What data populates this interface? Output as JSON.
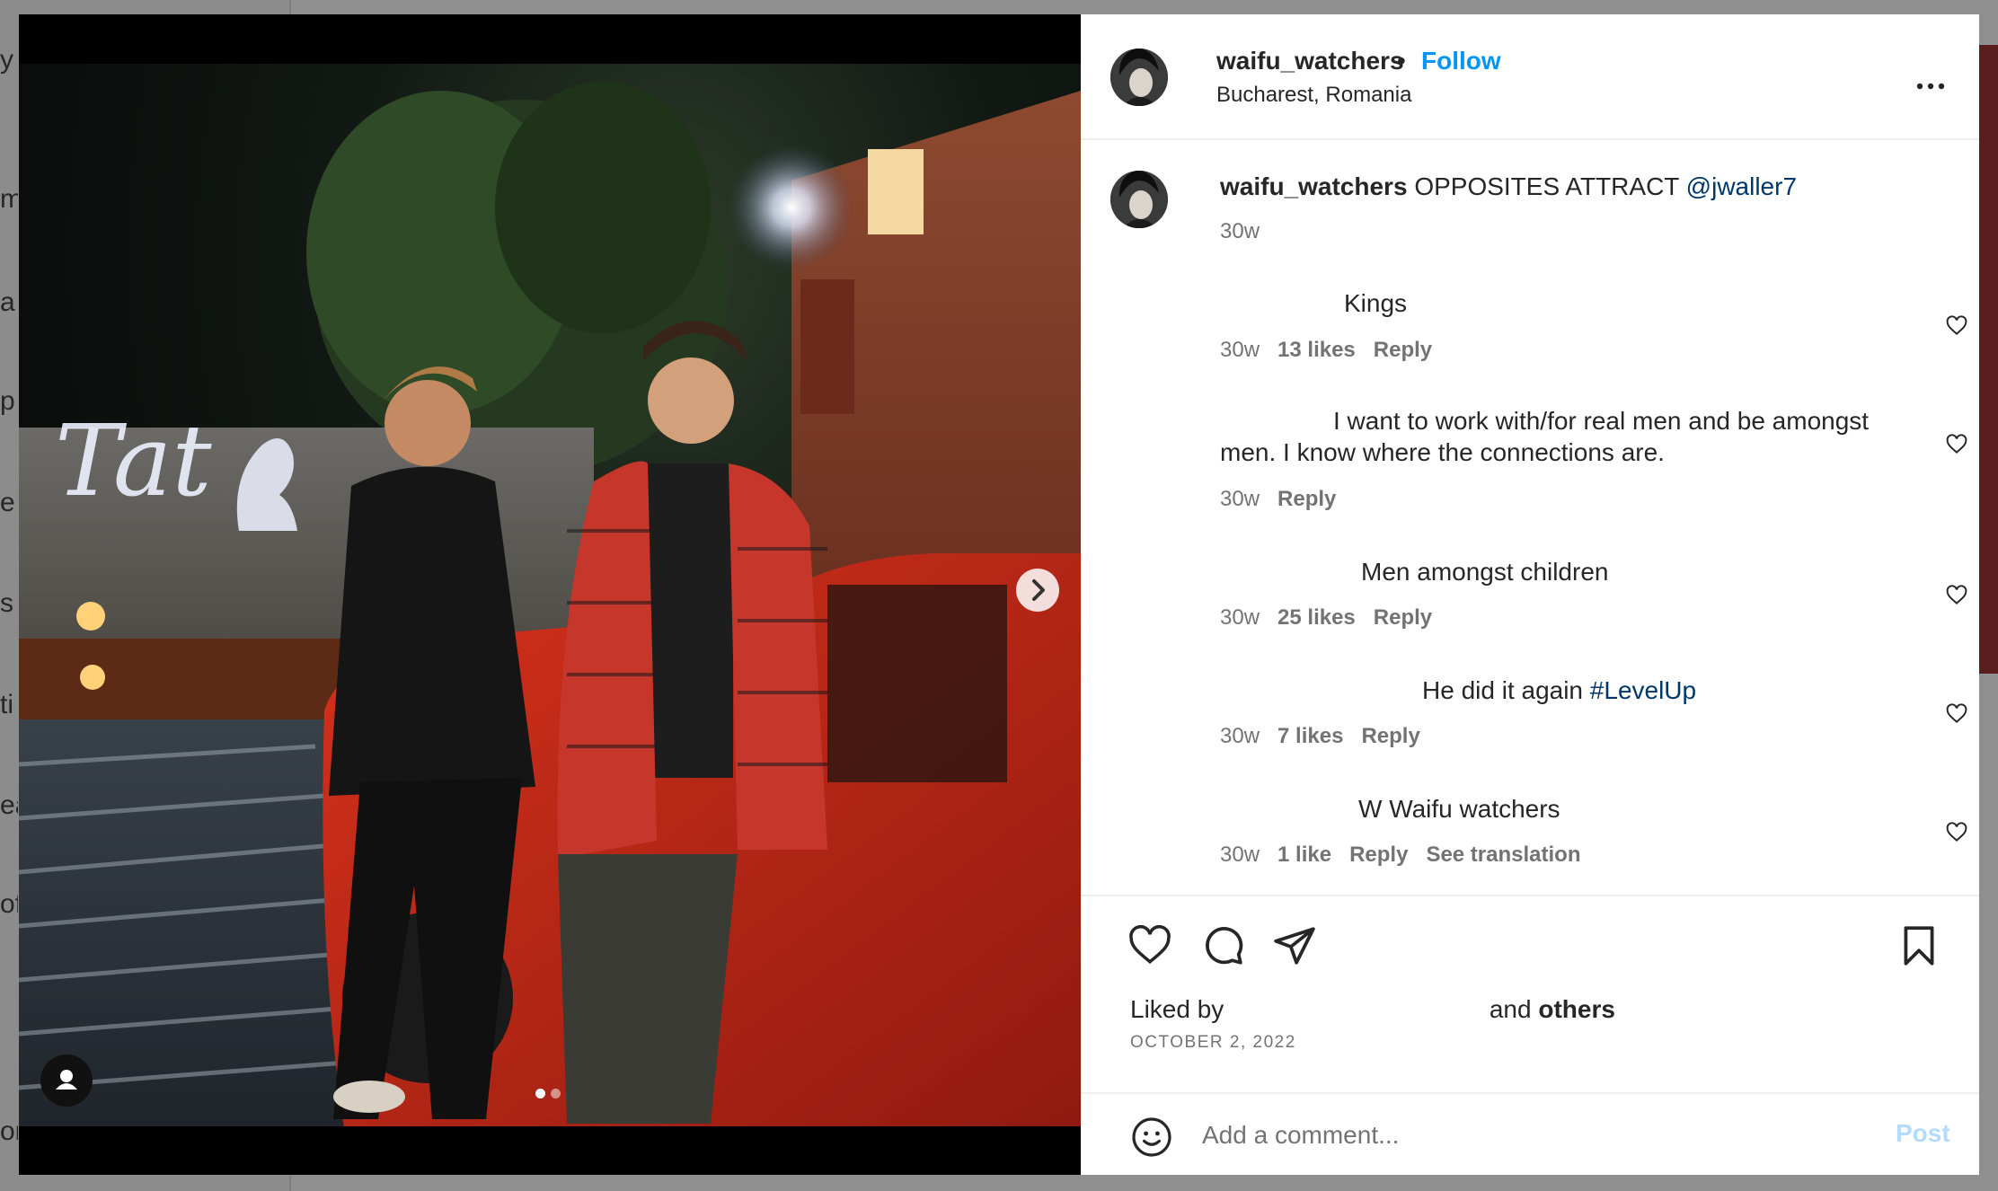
{
  "post": {
    "username": "waifu_watchers",
    "separator": "•",
    "follow_label": "Follow",
    "location": "Bucharest, Romania",
    "caption": {
      "username": "waifu_watchers",
      "text": "OPPOSITES ATTRACT",
      "mention": "@jwaller7",
      "age": "30w"
    },
    "media": {
      "current_slide": 1,
      "total_slides": 2
    }
  },
  "comments": [
    {
      "text": "Kings",
      "hashtag": "",
      "age": "30w",
      "likes": "13 likes",
      "reply": "Reply",
      "translation": ""
    },
    {
      "text_line1": "I want to work with/for real men and be amongst",
      "text_line2": "men. I know where the connections are.",
      "age": "30w",
      "likes": "",
      "reply": "Reply",
      "translation": ""
    },
    {
      "text": "Men amongst children",
      "hashtag": "",
      "age": "30w",
      "likes": "25 likes",
      "reply": "Reply",
      "translation": ""
    },
    {
      "text": "He did it again",
      "hashtag": "#LevelUp",
      "age": "30w",
      "likes": "7 likes",
      "reply": "Reply",
      "translation": ""
    },
    {
      "text": "W Waifu watchers",
      "hashtag": "",
      "age": "30w",
      "likes": "1 like",
      "reply": "Reply",
      "translation": "See translation"
    }
  ],
  "actions": {
    "liked_by_prefix": "Liked by",
    "liked_by_and": "and",
    "liked_by_others": "others",
    "date": "OCTOBER 2, 2022"
  },
  "add_comment": {
    "placeholder": "Add a comment...",
    "post_label": "Post"
  },
  "icons": {
    "more": "more-horizontal-icon",
    "like": "heart-icon",
    "comment": "comment-icon",
    "share": "paper-plane-icon",
    "save": "bookmark-icon",
    "emoji": "emoji-icon",
    "next": "chevron-right-icon",
    "user_tag": "user-icon"
  },
  "colors": {
    "accent": "#0095f6",
    "link": "#00376b",
    "post_disabled": "#b3dbff",
    "secondary_text": "#737373"
  },
  "background_sidebar_fragments": [
    "y",
    "m",
    "a",
    "p",
    "e",
    "s",
    "ti",
    "ea",
    "of",
    "or"
  ]
}
